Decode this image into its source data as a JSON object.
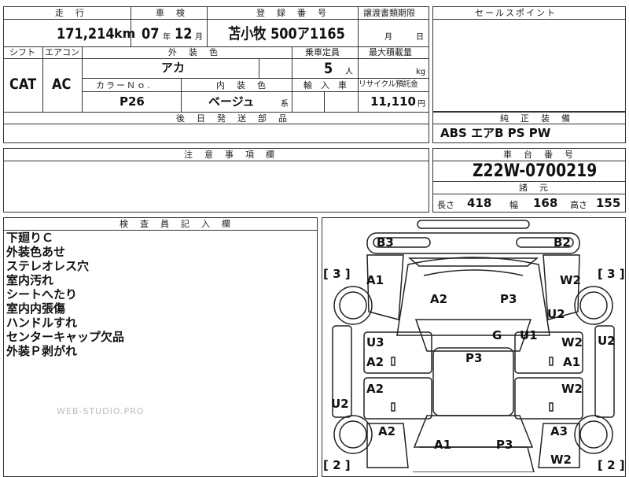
{
  "headers": {
    "mileage": "走　行",
    "inspection": "車　検",
    "registration": "登　録　番　号",
    "transfer": "譲渡書類期限",
    "sales_point": "セールスポイント",
    "shift": "シフト",
    "aircon": "エアコン",
    "exterior_color": "外　装　色",
    "capacity": "乗車定員",
    "max_load": "最大積載量",
    "color_no": "カラーＮｏ.",
    "interior_color": "内　装　色",
    "import": "輸　入　車",
    "recycle": "リサイクル預託金",
    "later_parts": "後　日　発　送　部　品",
    "standard_equipment": "純　正　装　備",
    "caution": "注　意　事　項　欄",
    "chassis_number": "車　台　番　号",
    "specs": "諸　元",
    "inspector_notes": "検　査　員　記　入　欄"
  },
  "vehicle": {
    "mileage_value": "171,214",
    "mileage_unit": "km",
    "inspection_year": "07",
    "year_unit": "年",
    "inspection_month": "12",
    "month_unit": "月",
    "registration_number": "苫小牧 500ア1165",
    "transfer_month_unit": "月",
    "transfer_day_unit": "日",
    "shift_value": "CAT",
    "aircon_value": "AC",
    "exterior_color_value": "アカ",
    "capacity_value": "5",
    "capacity_unit": "人",
    "load_unit": "kg",
    "color_no_value": "P26",
    "interior_color_value": "ベージュ",
    "interior_color_suffix": "系",
    "recycle_value": "11,110",
    "recycle_unit": "円",
    "equipment": "ABS エアB PS PW",
    "chassis_number_value": "Z22W-0700219",
    "length_label": "長さ",
    "length_value": "418",
    "width_label": "幅",
    "width_value": "168",
    "height_label": "高さ",
    "height_value": "155"
  },
  "inspector_notes": [
    "下廻りＣ",
    "外装色あせ",
    "ステレオレス穴",
    "室内汚れ",
    "シートへたり",
    "室内内張傷",
    "ハンドルすれ",
    "センターキャップ欠品",
    "外装Ｐ剥がれ"
  ],
  "watermark": "WEB-STUDIO.PRO",
  "diagram": {
    "b3": "B3",
    "b2": "B2",
    "bracket_tl": "[ 3 ]",
    "bracket_tr": "[ 3 ]",
    "bracket_bl": "[ 2 ]",
    "bracket_br": "[ 2 ]",
    "a1_fl": "A1",
    "a2_hood_l": "A2",
    "p3_hood_r": "P3",
    "w2_fr": "W2",
    "u2_fr": "U2",
    "u2_right": "U2",
    "g": "G",
    "u1": "U1",
    "u3": "U3",
    "a2_ldoor1": "A2",
    "p3_roof": "P3",
    "w2_rdoor1": "W2",
    "a1_rdoor1": "A1",
    "a2_ldoor2": "A2",
    "w2_rdoor2": "W2",
    "u2_left": "U2",
    "a2_rl": "A2",
    "a3_rr": "A3",
    "a1_trunk": "A1",
    "p3_trunk": "P3",
    "w2_bottom": "W2"
  }
}
